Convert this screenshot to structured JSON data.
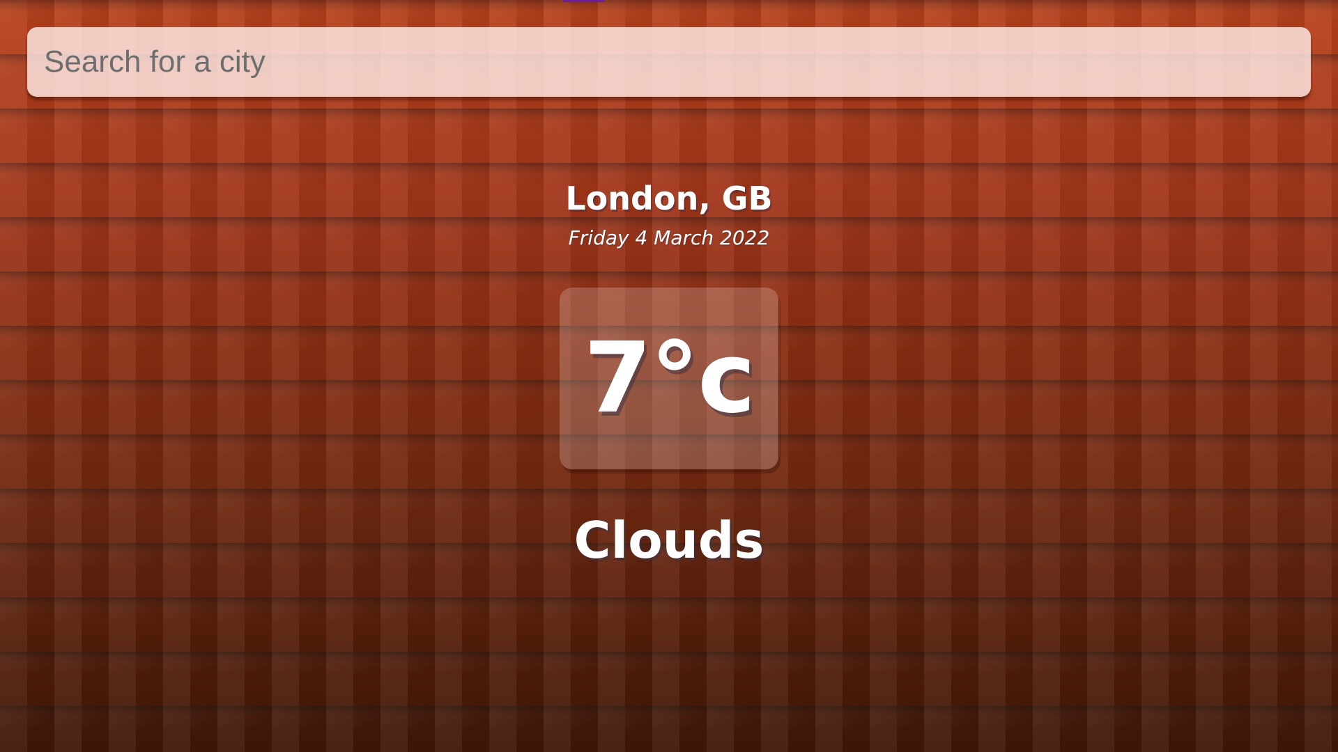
{
  "search": {
    "placeholder": "Search for a city",
    "value": ""
  },
  "location": {
    "city": "London, GB",
    "date": "Friday 4 March 2022"
  },
  "weather": {
    "temperature": "7°c",
    "condition": "Clouds"
  },
  "colors": {
    "background_top": "#b9411c",
    "background_bottom": "#401708",
    "accent_bar": "#6b1fa0",
    "text": "#ffffff",
    "search_background": "#ffece8"
  }
}
